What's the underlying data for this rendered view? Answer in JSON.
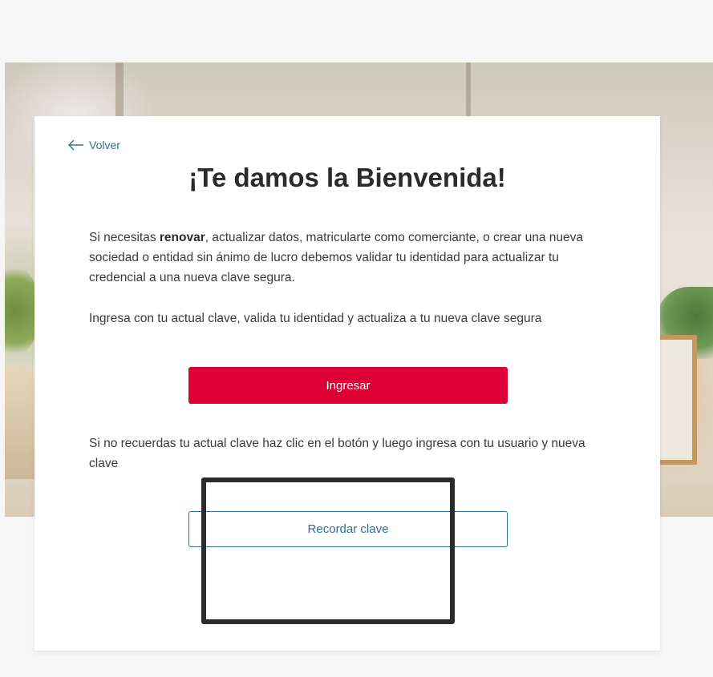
{
  "back": {
    "label": "Volver",
    "icon": "arrow-left-icon"
  },
  "heading": "¡Te damos la Bienvenida!",
  "intro": {
    "prefix": "Si necesitas ",
    "bold": "renovar",
    "suffix": ", actualizar datos, matricularte como comerciante, o crear una nueva sociedad o entidad sin ánimo de lucro debemos validar tu identidad para actualizar tu credencial a una nueva clave segura."
  },
  "instruction": "Ingresa con tu actual clave, valida tu identidad y actualiza a tu nueva clave segura",
  "login_button": "Ingresar",
  "forgot_text": "Si no recuerdas tu actual clave haz clic en el botón y luego ingresa con tu usuario y nueva clave",
  "remember_button": "Recordar clave",
  "colors": {
    "primary": "#dc0034",
    "link": "#2f6f96",
    "text": "#3b3b3b"
  }
}
